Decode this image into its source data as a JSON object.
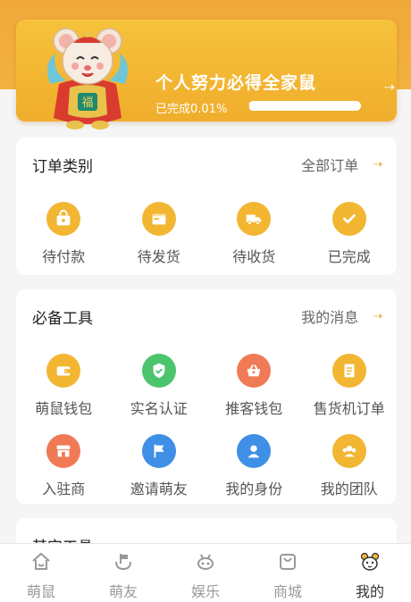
{
  "banner": {
    "title": "个人努力必得全家鼠",
    "progress_text": "已完成0.01%",
    "progress_fraction": 0.01,
    "arrow": "⇢"
  },
  "orders": {
    "title": "订单类别",
    "link": "全部订单",
    "link_arrow": "⇢",
    "items": [
      {
        "label": "待付款",
        "icon": "wallet-bag-icon",
        "color": "#f2b632"
      },
      {
        "label": "待发货",
        "icon": "box-icon",
        "color": "#f2b632"
      },
      {
        "label": "待收货",
        "icon": "truck-icon",
        "color": "#f2b632"
      },
      {
        "label": "已完成",
        "icon": "check-icon",
        "color": "#f2b632"
      }
    ]
  },
  "tools": {
    "title": "必备工具",
    "link": "我的消息",
    "link_arrow": "⇢",
    "rows": [
      [
        {
          "label": "萌鼠钱包",
          "icon": "wallet-icon",
          "color": "#f2b632"
        },
        {
          "label": "实名认证",
          "icon": "verified-icon",
          "color": "#4cc46e"
        },
        {
          "label": "推客钱包",
          "icon": "basket-icon",
          "color": "#f07a55"
        },
        {
          "label": "售货机订单",
          "icon": "document-icon",
          "color": "#f2b632"
        }
      ],
      [
        {
          "label": "入驻商",
          "icon": "store-icon",
          "color": "#f07a55"
        },
        {
          "label": "邀请萌友",
          "icon": "flag-icon",
          "color": "#3f8fe6"
        },
        {
          "label": "我的身份",
          "icon": "id-person-icon",
          "color": "#3f8fe6"
        },
        {
          "label": "我的团队",
          "icon": "team-icon",
          "color": "#f2b632"
        }
      ]
    ]
  },
  "other": {
    "title": "其它工具"
  },
  "nav": {
    "items": [
      {
        "label": "萌鼠",
        "icon": "home-icon",
        "active": false
      },
      {
        "label": "萌友",
        "icon": "friends-icon",
        "active": false
      },
      {
        "label": "娱乐",
        "icon": "entertainment-icon",
        "active": false
      },
      {
        "label": "商城",
        "icon": "shop-icon",
        "active": false
      },
      {
        "label": "我的",
        "icon": "profile-mouse-icon",
        "active": true
      }
    ]
  },
  "colors": {
    "accent": "#f2b632",
    "banner_bg": "#f6c23b",
    "header_bg": "#f0a83a"
  }
}
